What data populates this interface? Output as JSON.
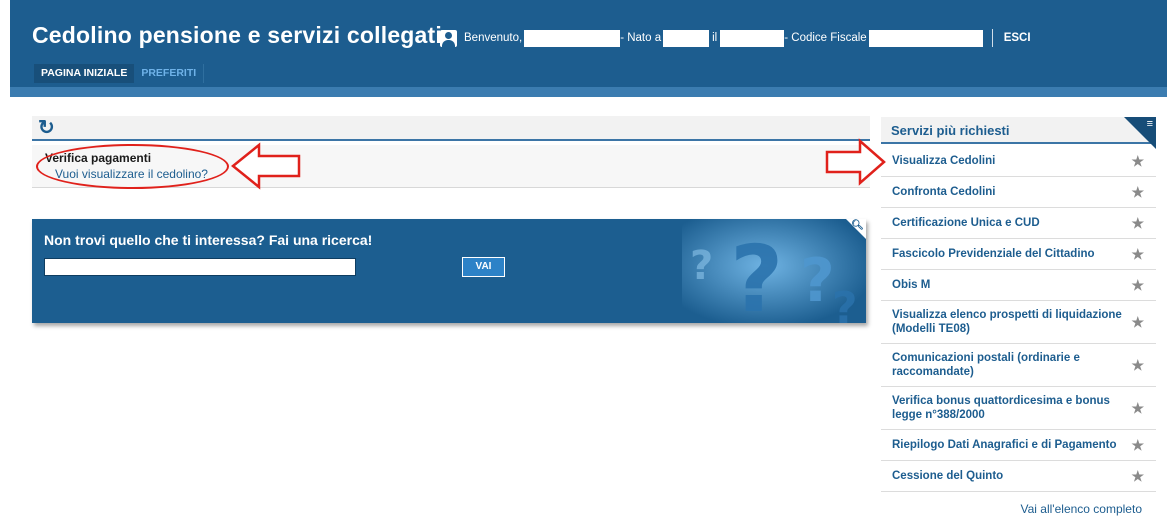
{
  "header": {
    "title": "Cedolino pensione e servizi collegati",
    "welcome_label": "Benvenuto,",
    "born_label": "- Nato a",
    "on_label": "il",
    "fiscal_label": "- Codice Fiscale",
    "logout_label": "ESCI",
    "nav": [
      {
        "label": "PAGINA INIZIALE"
      },
      {
        "label": "PREFERITI"
      }
    ]
  },
  "main": {
    "verifica_title": "Verifica pagamenti",
    "verifica_link": "Vuoi visualizzare il cedolino?",
    "search_title": "Non trovi quello che ti interessa? Fai una ricerca!",
    "search_value": "",
    "search_button": "VAI"
  },
  "sidebar": {
    "title": "Servizi più richiesti",
    "items": [
      {
        "label": "Visualizza Cedolini"
      },
      {
        "label": "Confronta Cedolini"
      },
      {
        "label": "Certificazione Unica e CUD"
      },
      {
        "label": "Fascicolo Previdenziale del Cittadino"
      },
      {
        "label": "Obis M"
      },
      {
        "label": "Visualizza elenco prospetti di liquidazione (Modelli TE08)"
      },
      {
        "label": "Comunicazioni postali (ordinarie e raccomandate)"
      },
      {
        "label": "Verifica bonus quattordicesima e bonus legge n°388/2000"
      },
      {
        "label": "Riepilogo Dati Anagrafici e di Pagamento"
      },
      {
        "label": "Cessione del Quinto"
      }
    ],
    "more_link": "Vai all'elenco completo"
  },
  "colors": {
    "brand_blue": "#1d5d8f",
    "annotation_red": "#e0211b"
  }
}
